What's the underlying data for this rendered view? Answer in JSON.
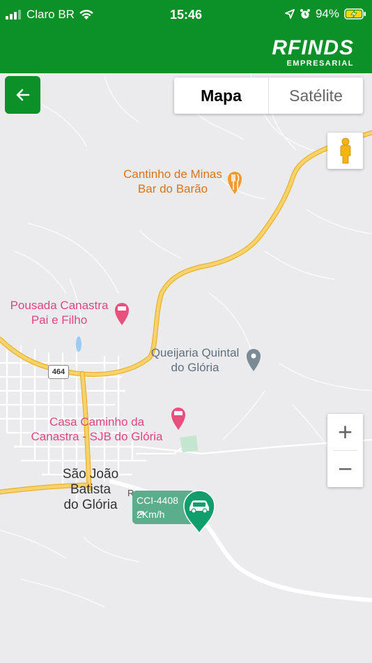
{
  "status_bar": {
    "carrier": "Claro BR",
    "time": "15:46",
    "battery": "94%",
    "icons": [
      "signal-icon",
      "wifi-icon",
      "location-arrow-icon",
      "alarm-icon",
      "battery-charging-icon"
    ]
  },
  "header": {
    "brand_main": "RFINDS",
    "brand_sub": "EMPRESARIAL",
    "background": "#0b9128"
  },
  "map_controls": {
    "map_label": "Mapa",
    "satellite_label": "Satélite",
    "zoom_in": "+",
    "zoom_out": "−"
  },
  "map": {
    "pois": [
      {
        "line1": "Cantinho de Minas",
        "line2": "Bar do Barão",
        "type": "restaurant"
      },
      {
        "line1": "Pousada Canastra",
        "line2": "Pai e Filho",
        "type": "lodging"
      },
      {
        "line1": "Queijaria Quintal",
        "line2": "do Glória",
        "type": "place"
      },
      {
        "line1": "Casa Caminho da",
        "line2": "Canastra - SJB do Glória",
        "type": "lodging"
      }
    ],
    "town": {
      "line1": "São João",
      "line2": "Batista",
      "line3": "do Glória"
    },
    "road_shield": "464",
    "road_letter": "R"
  },
  "vehicle": {
    "plate": "CCI-4408",
    "speed": "2Km/h",
    "color": "#5aae8c",
    "marker_color": "#109e6c"
  }
}
